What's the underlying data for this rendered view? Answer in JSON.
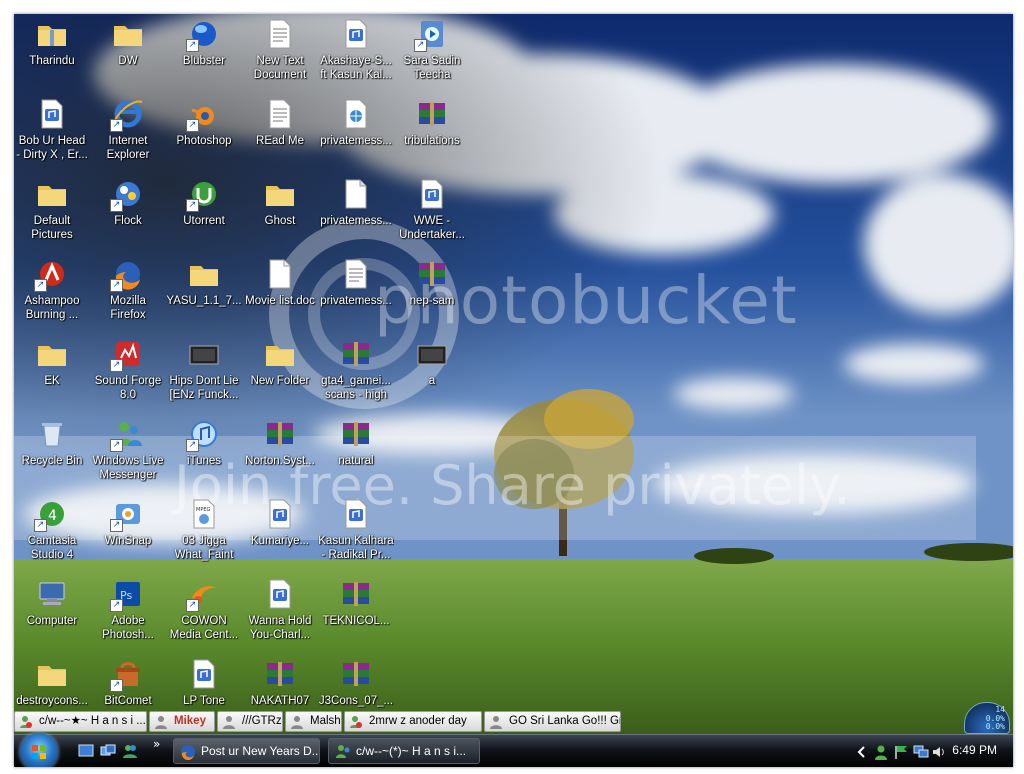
{
  "desktop": {
    "icons": [
      {
        "label": "Tharindu",
        "icon": "folder-zip-icon",
        "name": "desktop-icon-tharindu"
      },
      {
        "label": "Bob Ur Head\n- Dirty X , Er...",
        "icon": "audio-file-icon",
        "name": "desktop-icon-bob-ur-head"
      },
      {
        "label": "Default\nPictures",
        "icon": "folder-icon",
        "name": "desktop-icon-default-pictures"
      },
      {
        "label": "Ashampoo\nBurning ...",
        "icon": "ashampoo-icon",
        "name": "desktop-icon-ashampoo"
      },
      {
        "label": "EK",
        "icon": "folder-icon",
        "name": "desktop-icon-ek"
      },
      {
        "label": "Recycle Bin",
        "icon": "recycle-bin-icon",
        "name": "desktop-icon-recycle-bin"
      },
      {
        "label": "Camtasia\nStudio 4",
        "icon": "camtasia-icon",
        "name": "desktop-icon-camtasia"
      },
      {
        "label": "Computer",
        "icon": "computer-icon",
        "name": "desktop-icon-computer"
      },
      {
        "label": "destroycons...",
        "icon": "folder-icon",
        "name": "desktop-icon-destroycons"
      },
      {
        "label": "DW",
        "icon": "folder-icon",
        "name": "desktop-icon-dw"
      },
      {
        "label": "Internet\nExplorer",
        "icon": "internet-explorer-icon",
        "name": "desktop-icon-internet-explorer"
      },
      {
        "label": "Flock",
        "icon": "flock-icon",
        "name": "desktop-icon-flock"
      },
      {
        "label": "Mozilla\nFirefox",
        "icon": "firefox-icon",
        "name": "desktop-icon-firefox"
      },
      {
        "label": "Sound Forge\n8.0",
        "icon": "sound-forge-icon",
        "name": "desktop-icon-sound-forge"
      },
      {
        "label": "Windows Live\nMessenger",
        "icon": "messenger-icon",
        "name": "desktop-icon-messenger"
      },
      {
        "label": "WinSnap",
        "icon": "winsnap-icon",
        "name": "desktop-icon-winsnap"
      },
      {
        "label": "Adobe\nPhotosh...",
        "icon": "photoshop-icon",
        "name": "desktop-icon-adobe-photoshop"
      },
      {
        "label": "BitComet",
        "icon": "bitcomet-icon",
        "name": "desktop-icon-bitcomet"
      },
      {
        "label": "Blubster",
        "icon": "blubster-icon",
        "name": "desktop-icon-blubster"
      },
      {
        "label": "Photoshop",
        "icon": "blender-icon",
        "name": "desktop-icon-photoshop"
      },
      {
        "label": "Utorrent",
        "icon": "utorrent-icon",
        "name": "desktop-icon-utorrent"
      },
      {
        "label": "YASU_1.1_7...",
        "icon": "folder-icon",
        "name": "desktop-icon-yasu"
      },
      {
        "label": "Hips Dont Lie\n[ENz Funck...",
        "icon": "video-thumbnail-icon",
        "name": "desktop-icon-hips-dont-lie"
      },
      {
        "label": "iTunes",
        "icon": "itunes-icon",
        "name": "desktop-icon-itunes"
      },
      {
        "label": "03 Jigga\nWhat_Faint",
        "icon": "mpeg-file-icon",
        "name": "desktop-icon-03-jigga"
      },
      {
        "label": "COWON\nMedia Cent...",
        "icon": "cowon-icon",
        "name": "desktop-icon-cowon"
      },
      {
        "label": "LP Tone",
        "icon": "audio-file-icon",
        "name": "desktop-icon-lp-tone"
      },
      {
        "label": "New Text\nDocument",
        "icon": "text-file-icon",
        "name": "desktop-icon-new-text-document"
      },
      {
        "label": "REad Me",
        "icon": "text-file-icon",
        "name": "desktop-icon-read-me"
      },
      {
        "label": "Ghost",
        "icon": "folder-icon",
        "name": "desktop-icon-ghost"
      },
      {
        "label": "Movie list.doc",
        "icon": "document-icon",
        "name": "desktop-icon-movie-list"
      },
      {
        "label": "New Folder",
        "icon": "folder-icon",
        "name": "desktop-icon-new-folder"
      },
      {
        "label": "Norton.Syst...",
        "icon": "winrar-archive-icon",
        "name": "desktop-icon-norton"
      },
      {
        "label": "Kumariye...",
        "icon": "audio-file-icon",
        "name": "desktop-icon-kumariye"
      },
      {
        "label": "Wanna Hold\nYou-Charl...",
        "icon": "audio-file-icon",
        "name": "desktop-icon-wanna-hold-you"
      },
      {
        "label": "NAKATH07",
        "icon": "winrar-archive-icon",
        "name": "desktop-icon-nakath07"
      },
      {
        "label": "Akashaye-S...\nft Kasun Kal...",
        "icon": "audio-file-icon",
        "name": "desktop-icon-akashaye"
      },
      {
        "label": "privatemess...",
        "icon": "web-file-icon",
        "name": "desktop-icon-privatemess-1"
      },
      {
        "label": "privatemess...",
        "icon": "blank-file-icon",
        "name": "desktop-icon-privatemess-2"
      },
      {
        "label": "privatemess...",
        "icon": "text-file-icon",
        "name": "desktop-icon-privatemess-3"
      },
      {
        "label": "gta4_gamei...\nscans - high",
        "icon": "winrar-archive-icon",
        "name": "desktop-icon-gta4"
      },
      {
        "label": "natural",
        "icon": "winrar-archive-icon",
        "name": "desktop-icon-natural"
      },
      {
        "label": "Kasun Kalhara\n- Radikal Pr...",
        "icon": "audio-file-icon",
        "name": "desktop-icon-kasun-kalhara"
      },
      {
        "label": "TEKNICOL...",
        "icon": "winrar-archive-icon",
        "name": "desktop-icon-teknicol"
      },
      {
        "label": "J3Cons_07_...",
        "icon": "winrar-archive-icon",
        "name": "desktop-icon-j3cons"
      },
      {
        "label": "Sara Sadin\nTeecha",
        "icon": "media-shortcut-icon",
        "name": "desktop-icon-sara-sadin"
      },
      {
        "label": "tribulations",
        "icon": "winrar-archive-icon",
        "name": "desktop-icon-tribulations"
      },
      {
        "label": "WWE -\nUndertaker...",
        "icon": "audio-file-icon",
        "name": "desktop-icon-wwe"
      },
      {
        "label": "nep-sam",
        "icon": "winrar-archive-icon",
        "name": "desktop-icon-nep-sam"
      },
      {
        "label": "a",
        "icon": "video-thumbnail-icon",
        "name": "desktop-icon-a"
      }
    ]
  },
  "watermark": {
    "brand": "photobucket",
    "tagline": "Join free. Share privately."
  },
  "chat_bar": {
    "tabs": [
      {
        "label": "c/w--~★~ H a n s i ..."
      },
      {
        "label": "Mikey"
      },
      {
        "label": "///GTRz"
      },
      {
        "label": "Malshi"
      },
      {
        "label": "2mrw z anoder day"
      },
      {
        "label": "GO Sri Lanka Go!!! Gr..."
      }
    ]
  },
  "taskbar": {
    "show_more": "»",
    "buttons": [
      {
        "label": "Post ur New Years D...",
        "icon": "firefox-icon"
      },
      {
        "label": "c/w--~(*)~ H a n s i...",
        "icon": "messenger-icon"
      }
    ],
    "clock": "6:49 PM",
    "tray_icons": [
      "chevron-left-icon",
      "messenger-status-icon",
      "flag-icon",
      "network-icon",
      "volume-icon"
    ]
  },
  "gadget": {
    "line1": "0.0%",
    "line2": "0.0%",
    "top": "14"
  },
  "colors": {
    "sky_top": "#0e2a6e",
    "grass": "#5a8a2c",
    "chat_tab_bg": "#e6e6e6",
    "taskbar": "#101418"
  }
}
